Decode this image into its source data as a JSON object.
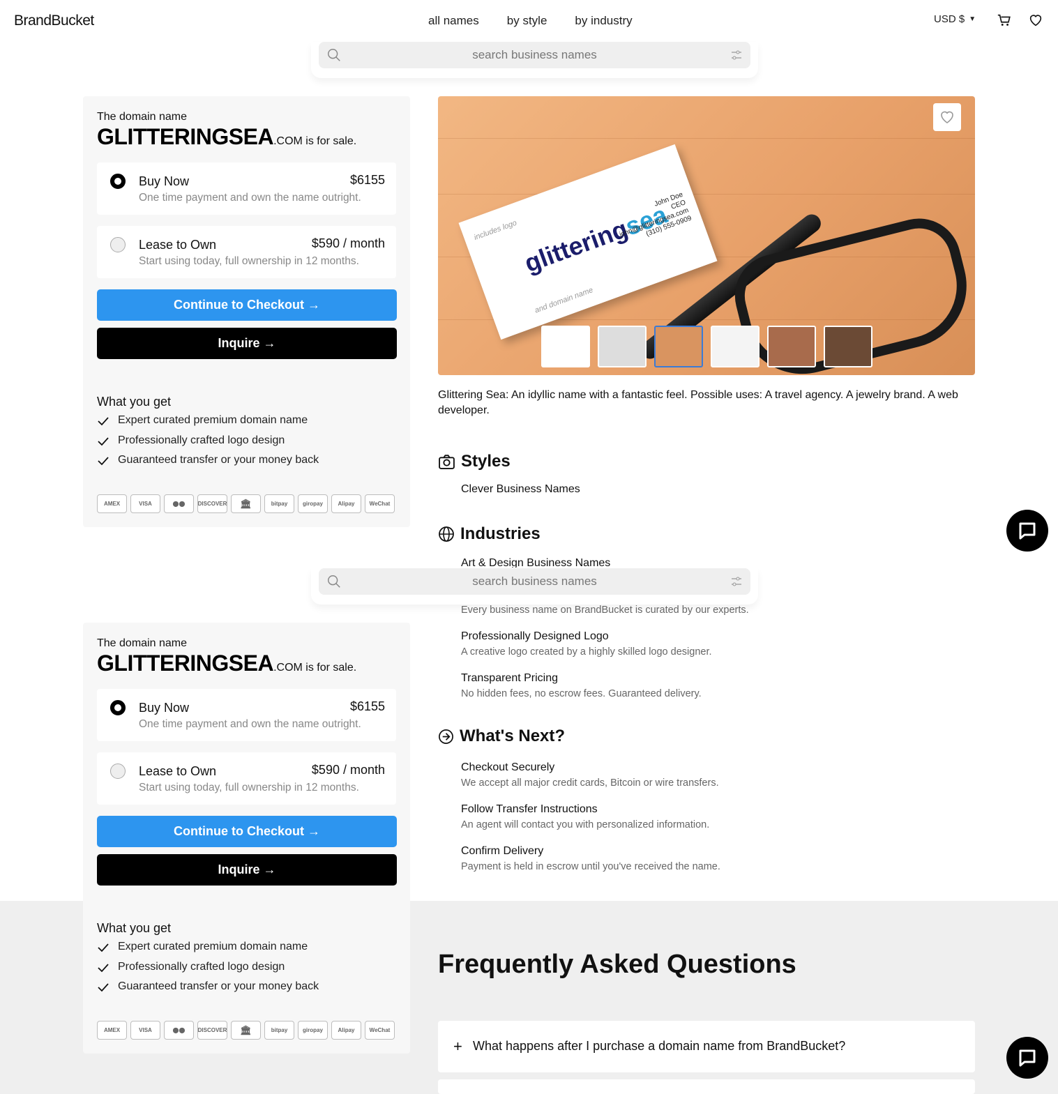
{
  "header": {
    "logo": "BrandBucket",
    "nav": [
      "all names",
      "by style",
      "by industry"
    ],
    "currency": "USD $"
  },
  "search": {
    "placeholder": "search business names"
  },
  "card": {
    "lead": "The domain name",
    "domain": "GLITTERINGSEA",
    "tld": ".COM",
    "for_sale": " is for sale.",
    "buy_now": {
      "title": "Buy Now",
      "price": "$6155",
      "sub": "One time payment and own the name outright."
    },
    "lease": {
      "title": "Lease to Own",
      "price": "$590 / month",
      "sub": "Start using today, full ownership in 12 months."
    },
    "checkout_label": "Continue to Checkout",
    "inquire_label": "Inquire",
    "wyg_title": "What you get",
    "wyg": [
      "Expert curated premium domain name",
      "Professionally crafted logo design",
      "Guaranteed transfer or your money back"
    ],
    "payments": [
      "AMEX",
      "VISA",
      "MC",
      "DISCOVER",
      "BANK",
      "bitpay",
      "giropay",
      "Alipay",
      "WeChat"
    ]
  },
  "hero": {
    "brand_main": "glittering",
    "brand_accent": "sea",
    "note_top": "includes logo",
    "note_bottom": "and domain name",
    "contact": [
      "John Doe",
      "CEO",
      "john@glitteringsea.com",
      "(310) 555-0909"
    ]
  },
  "description": "Glittering Sea: An idyllic name with a fantastic feel. Possible uses: A travel agency. A jewelry brand. A web developer.",
  "styles": {
    "title": "Styles",
    "item": "Clever Business Names"
  },
  "industries": {
    "title": "Industries",
    "item": "Art & Design Business Names"
  },
  "features": [
    {
      "sub": "Every business name on BrandBucket is curated by our experts."
    },
    {
      "title": "Professionally Designed Logo",
      "sub": "A creative logo created by a highly skilled logo designer."
    },
    {
      "title": "Transparent Pricing",
      "sub": "No hidden fees, no escrow fees. Guaranteed delivery."
    }
  ],
  "whats_next": {
    "title": "What's Next?",
    "items": [
      {
        "title": "Checkout Securely",
        "sub": "We accept all major credit cards, Bitcoin or wire transfers."
      },
      {
        "title": "Follow Transfer Instructions",
        "sub": "An agent will contact you with personalized information."
      },
      {
        "title": "Confirm Delivery",
        "sub": "Payment is held in escrow until you've received the name."
      }
    ]
  },
  "faq": {
    "title": "Frequently Asked Questions",
    "items": [
      "What happens after I purchase a domain name from BrandBucket?"
    ]
  }
}
